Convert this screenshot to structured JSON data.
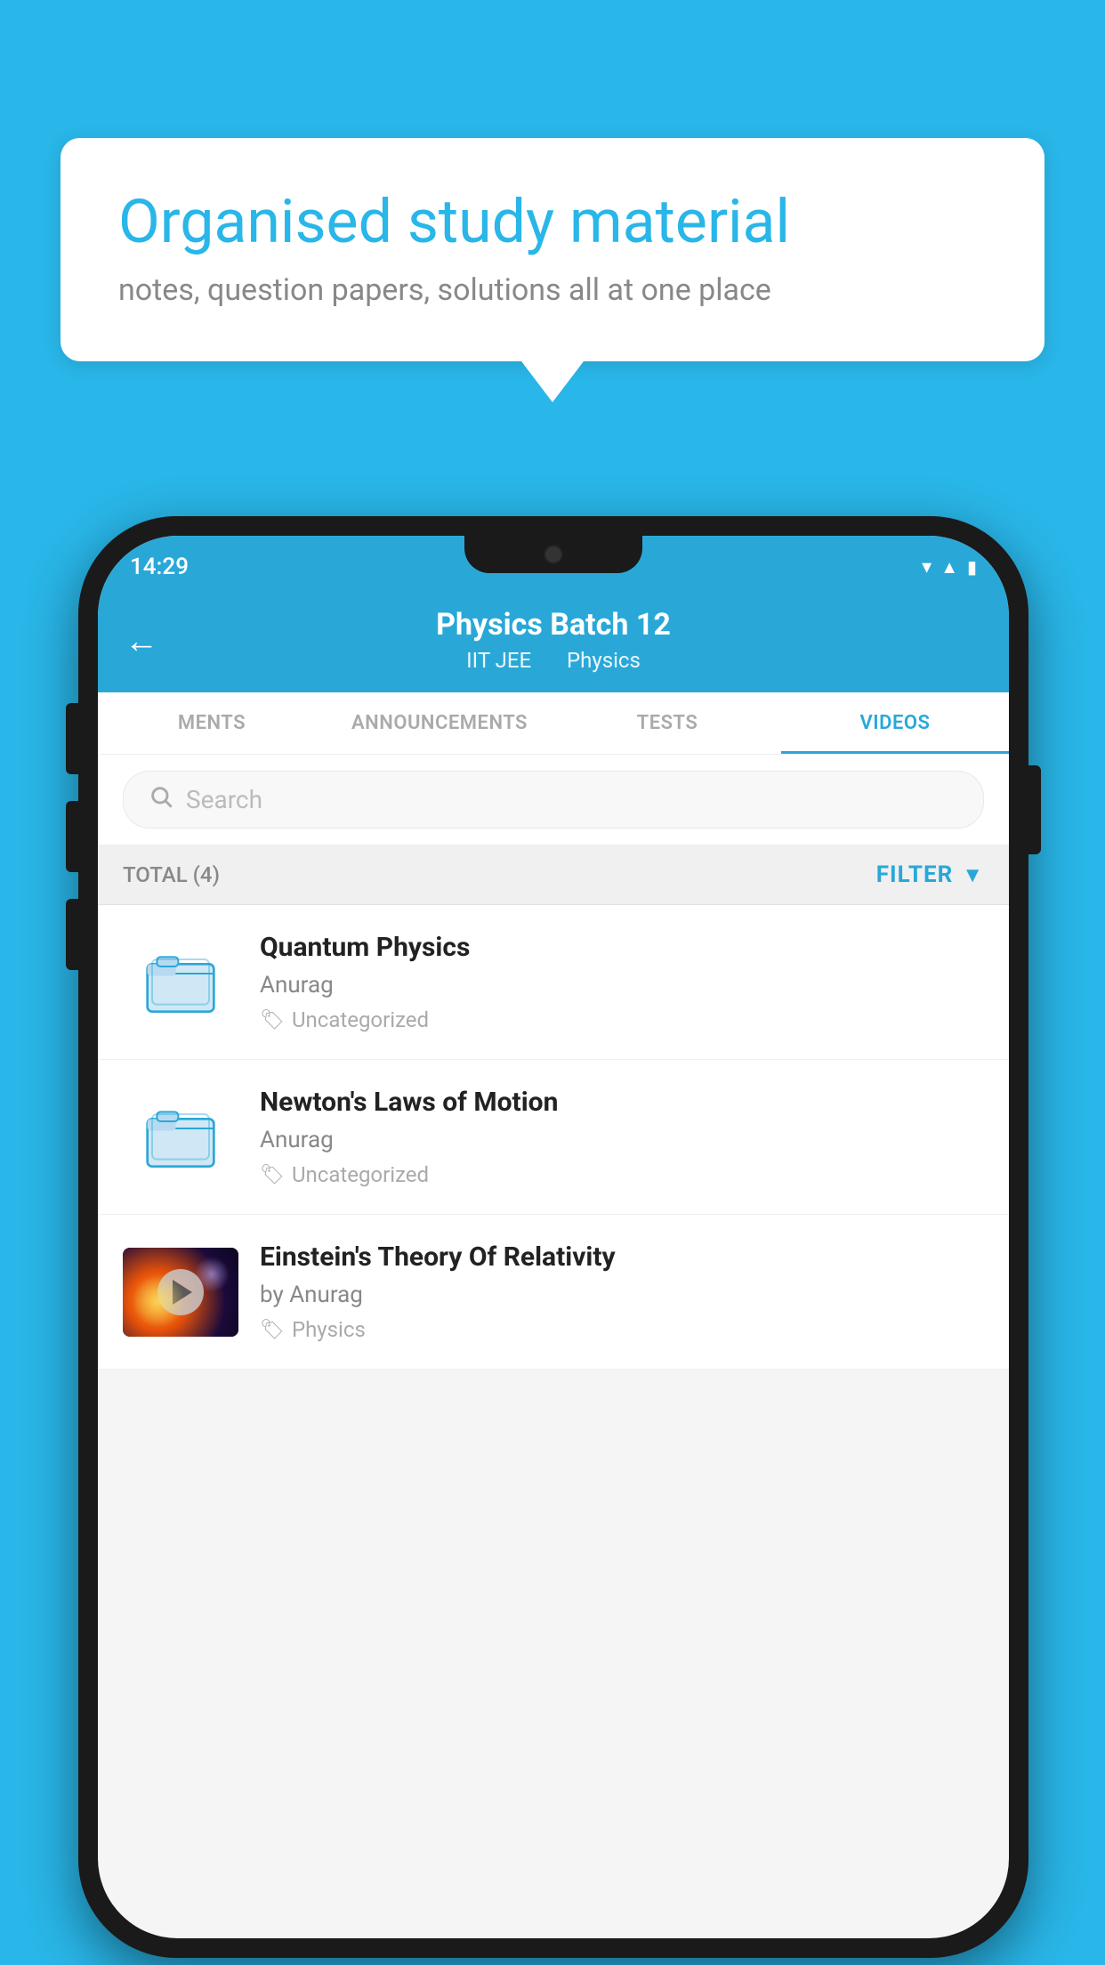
{
  "background": {
    "color": "#29b6e8"
  },
  "speech_bubble": {
    "title": "Organised study material",
    "subtitle": "notes, question papers, solutions all at one place"
  },
  "status_bar": {
    "time": "14:29",
    "wifi": "▾",
    "signal": "▲",
    "battery": "▮"
  },
  "app_header": {
    "back_label": "←",
    "title": "Physics Batch 12",
    "category1": "IIT JEE",
    "category2": "Physics"
  },
  "tabs": [
    {
      "label": "MENTS",
      "active": false
    },
    {
      "label": "ANNOUNCEMENTS",
      "active": false
    },
    {
      "label": "TESTS",
      "active": false
    },
    {
      "label": "VIDEOS",
      "active": true
    }
  ],
  "search": {
    "placeholder": "Search"
  },
  "filter_bar": {
    "total_label": "TOTAL (4)",
    "filter_label": "FILTER"
  },
  "videos": [
    {
      "id": 1,
      "title": "Quantum Physics",
      "author": "Anurag",
      "tag": "Uncategorized",
      "has_thumbnail": false
    },
    {
      "id": 2,
      "title": "Newton's Laws of Motion",
      "author": "Anurag",
      "tag": "Uncategorized",
      "has_thumbnail": false
    },
    {
      "id": 3,
      "title": "Einstein's Theory Of Relativity",
      "author": "by Anurag",
      "tag": "Physics",
      "has_thumbnail": true
    }
  ]
}
